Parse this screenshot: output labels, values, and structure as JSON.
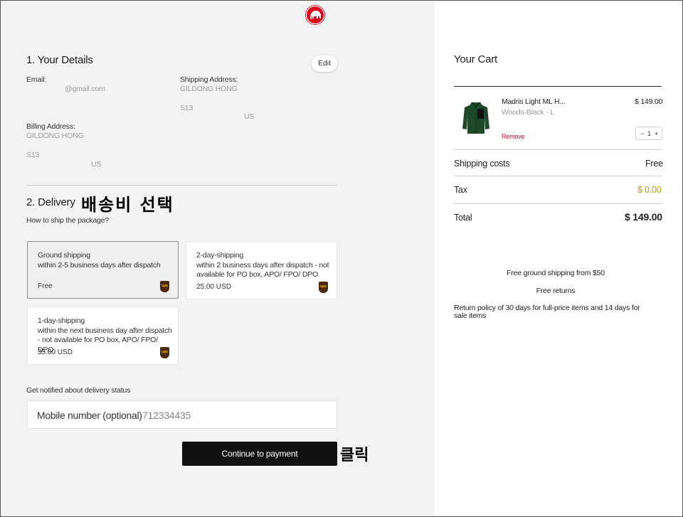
{
  "brand": {
    "logo_icon": "mammoth-logo-icon",
    "color": "#e2001a"
  },
  "details": {
    "heading": "1. Your Details",
    "edit_label": "Edit",
    "email_label": "Email:",
    "email_value": "@gmail.com",
    "shipping_label": "Shipping Address:",
    "shipping_name": "GILDONG HONG",
    "shipping_line2": "S13",
    "shipping_country": "US",
    "billing_label": "Billing Address:",
    "billing_name": "GILDONG HONG",
    "billing_line2": "S13",
    "billing_country": "US"
  },
  "delivery": {
    "heading": "2. Delivery",
    "annotation": "배송비 선택",
    "question": "How to ship the package?",
    "options": [
      {
        "name": "Ground shipping",
        "desc": "within 2-5 business days after dispatch",
        "price": "Free",
        "selected": true
      },
      {
        "name": "2-day-shipping",
        "desc": "within 2 business days after dispatch - not available for PO box, APO/ FPO/ DPO",
        "price": "25.00 USD",
        "selected": false
      },
      {
        "name": "1-day-shipping",
        "desc": "within the next business day after dispatch - not available for PO box, APO/ FPO/ DPO",
        "price": "35.00 USD",
        "selected": false
      }
    ],
    "carrier_icon": "ups-icon",
    "notify_label": "Get notified about delivery status",
    "mobile_label": "Mobile number (optional)",
    "mobile_value": "712334435",
    "continue_label": "Continue to payment",
    "click_annotation": "클릭"
  },
  "cart": {
    "heading": "Your Cart",
    "item": {
      "name": "Madris Light ML H...",
      "variant": "Woods-Black - L",
      "price": "$ 149.00",
      "remove_label": "Remove",
      "quantity": "1",
      "image_icon": "green-jacket-image"
    },
    "shipping_label": "Shipping costs",
    "shipping_value": "Free",
    "tax_label": "Tax",
    "tax_value": "$ 0.00",
    "tax_color": "#c49a00",
    "total_label": "Total",
    "total_value": "$ 149.00",
    "perk_1": "Free ground shipping from $50",
    "perk_2": "Free returns",
    "return_policy": "Return policy of 30 days for full-price items and 14 days for sale items"
  }
}
